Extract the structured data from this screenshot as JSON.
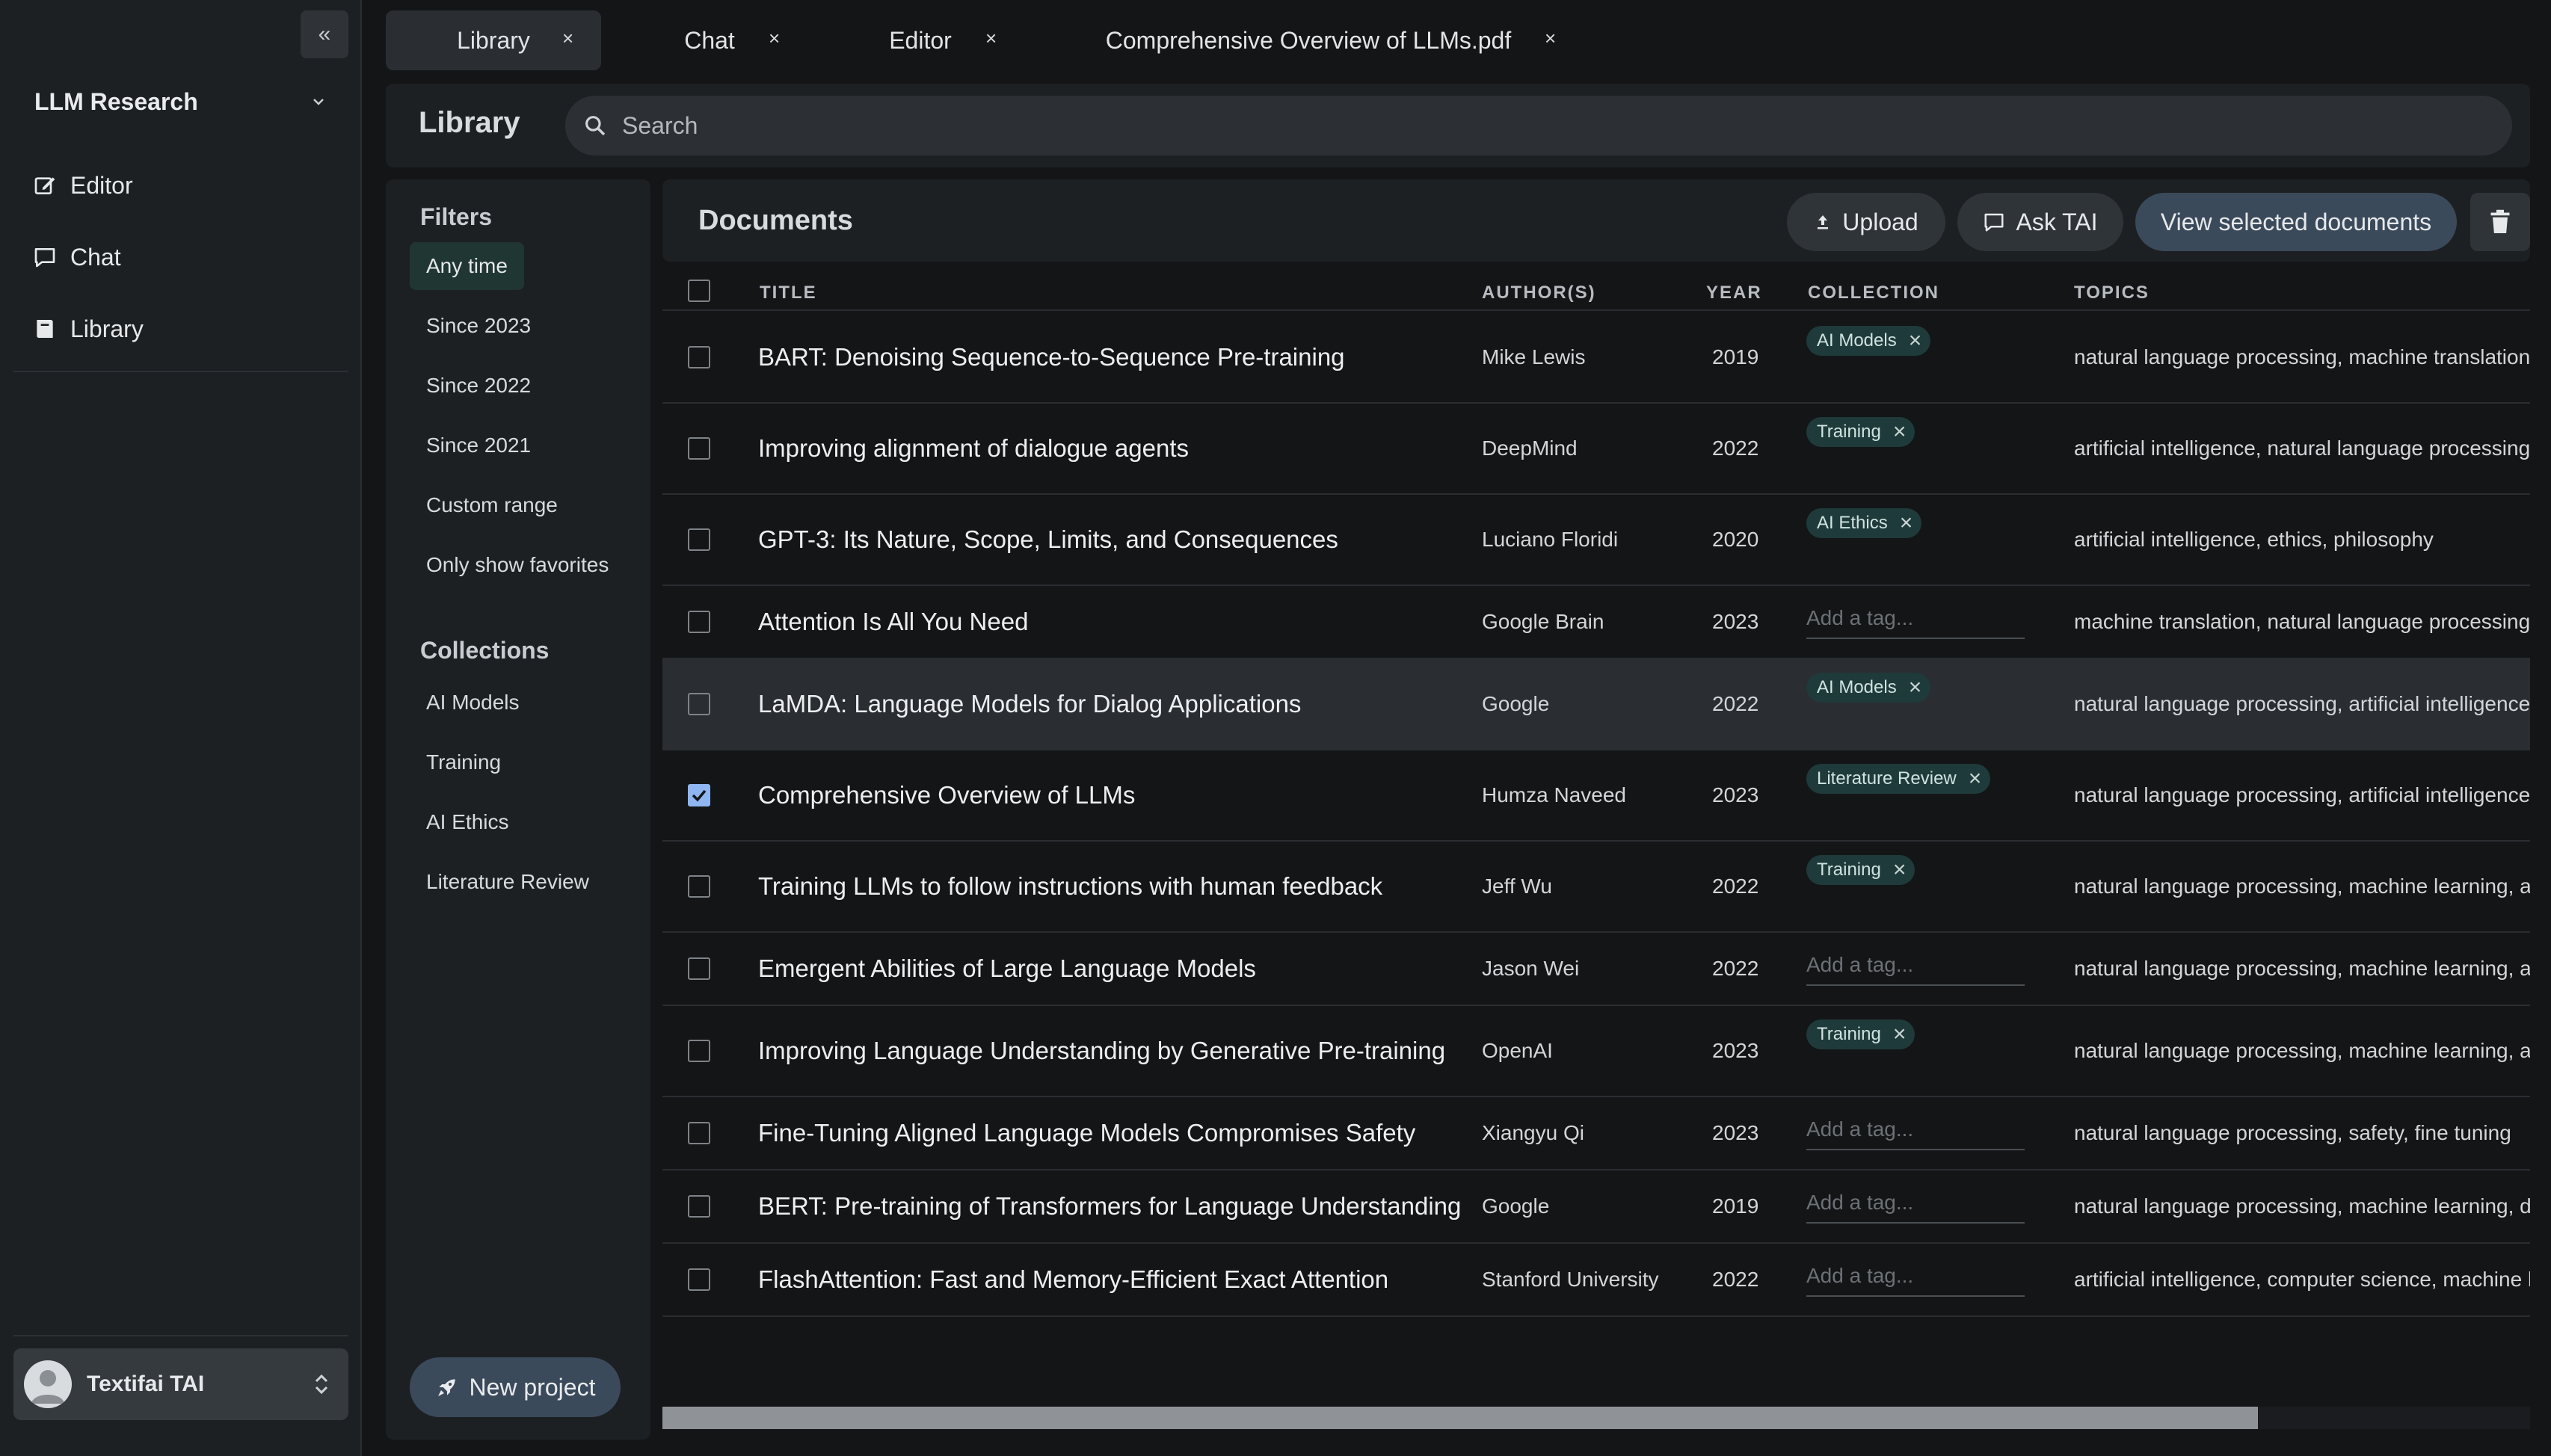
{
  "sidebar": {
    "collapse_icon": "«",
    "project_name": "LLM Research",
    "nav": [
      {
        "label": "Editor",
        "icon": "edit-icon"
      },
      {
        "label": "Chat",
        "icon": "chat-icon"
      },
      {
        "label": "Library",
        "icon": "book-icon"
      }
    ],
    "user_name": "Textifai TAI"
  },
  "tabs": [
    {
      "label": "Library",
      "active": true
    },
    {
      "label": "Chat",
      "active": false
    },
    {
      "label": "Editor",
      "active": false
    },
    {
      "label": "Comprehensive Overview of LLMs.pdf",
      "active": false
    }
  ],
  "library": {
    "title": "Library",
    "search_placeholder": "Search"
  },
  "filters": {
    "heading": "Filters",
    "items": [
      "Any time",
      "Since 2023",
      "Since 2022",
      "Since 2021",
      "Custom range",
      "Only show favorites"
    ],
    "selected": "Any time",
    "collections_heading": "Collections",
    "collections": [
      "AI Models",
      "Training",
      "AI Ethics",
      "Literature Review"
    ],
    "new_project_label": "New project"
  },
  "documents": {
    "title": "Documents",
    "upload_label": "Upload",
    "ask_label": "Ask TAI",
    "view_selected_label": "View selected documents",
    "columns": {
      "title": "TITLE",
      "authors": "AUTHOR(S)",
      "year": "YEAR",
      "collection": "COLLECTION",
      "topics": "TOPICS"
    },
    "tag_placeholder": "Add a tag...",
    "rows": [
      {
        "title": "BART: Denoising Sequence-to-Sequence Pre-training",
        "author": "Mike Lewis",
        "year": "2019",
        "collection": "AI Models",
        "topics": "natural language processing, machine translation,",
        "checked": false
      },
      {
        "title": "Improving alignment of dialogue agents",
        "author": "DeepMind",
        "year": "2022",
        "collection": "Training",
        "topics": "artificial intelligence, natural language processing,",
        "checked": false
      },
      {
        "title": "GPT-3: Its Nature, Scope, Limits, and Consequences",
        "author": "Luciano Floridi",
        "year": "2020",
        "collection": "AI Ethics",
        "topics": "artificial intelligence, ethics, philosophy",
        "checked": false
      },
      {
        "title": "Attention Is All You Need",
        "author": "Google Brain",
        "year": "2023",
        "collection": "",
        "topics": "machine translation, natural language processing,",
        "checked": false
      },
      {
        "title": "LaMDA: Language Models for Dialog Applications",
        "author": "Google",
        "year": "2022",
        "collection": "AI Models",
        "topics": "natural language processing, artificial intelligence,",
        "checked": false
      },
      {
        "title": "Comprehensive Overview of LLMs",
        "author": "Humza Naveed",
        "year": "2023",
        "collection": "Literature Review",
        "topics": "natural language processing, artificial intelligence,",
        "checked": true
      },
      {
        "title": "Training LLMs to follow instructions with human feedback",
        "author": "Jeff Wu",
        "year": "2022",
        "collection": "Training",
        "topics": "natural language processing, machine learning, art",
        "checked": false
      },
      {
        "title": "Emergent Abilities of Large Language Models",
        "author": "Jason Wei",
        "year": "2022",
        "collection": "",
        "topics": "natural language processing, machine learning, art",
        "checked": false
      },
      {
        "title": "Improving Language Understanding by Generative Pre-training",
        "author": "OpenAI",
        "year": "2023",
        "collection": "Training",
        "topics": "natural language processing, machine learning, art",
        "checked": false
      },
      {
        "title": "Fine-Tuning Aligned Language Models Compromises Safety",
        "author": "Xiangyu Qi",
        "year": "2023",
        "collection": "",
        "topics": "natural language processing, safety, fine tuning",
        "checked": false
      },
      {
        "title": "BERT: Pre-training of Transformers for Language Understanding",
        "author": "Google",
        "year": "2019",
        "collection": "",
        "topics": "natural language processing, machine learning, de",
        "checked": false
      },
      {
        "title": "FlashAttention: Fast and Memory-Efficient Exact Attention",
        "author": "Stanford University",
        "year": "2022",
        "collection": "",
        "topics": "artificial intelligence, computer science, machine le",
        "checked": false
      }
    ]
  }
}
